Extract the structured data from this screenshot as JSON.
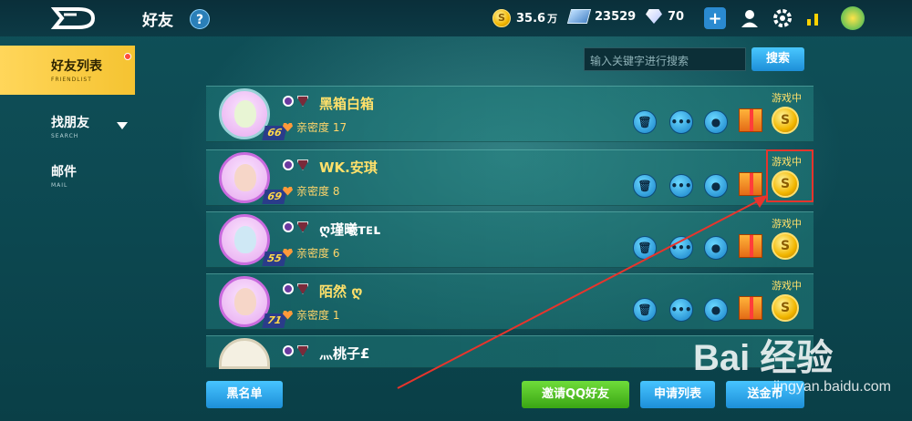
{
  "header": {
    "title": "好友",
    "help": "?",
    "coins": "35.6",
    "coins_unit": "万",
    "tickets": "23529",
    "diamonds": "70"
  },
  "sidebar": {
    "items": [
      {
        "label": "好友列表",
        "sub": "FRIENDLIST"
      },
      {
        "label": "找朋友",
        "sub": "SEARCH"
      },
      {
        "label": "邮件",
        "sub": "MAIL"
      }
    ]
  },
  "search": {
    "placeholder": "输入关键字进行搜索",
    "button": "搜索"
  },
  "friends": [
    {
      "level": "66",
      "name": "黑箱白箱",
      "intimacy": "亲密度 17",
      "status": "游戏中"
    },
    {
      "level": "69",
      "name": "WK.安琪",
      "intimacy": "亲密度 8",
      "status": "游戏中"
    },
    {
      "level": "55",
      "name": "ღ瑾曦ᴛᴇʟ",
      "intimacy": "亲密度 6",
      "status": "游戏中"
    },
    {
      "level": "71",
      "name": "陌然 ღ",
      "intimacy": "亲密度 1",
      "status": "游戏中"
    },
    {
      "level": "",
      "name": "灬桃子£",
      "intimacy": "",
      "status": ""
    }
  ],
  "bottom": {
    "blacklist": "黑名单",
    "invite_qq": "邀请QQ好友",
    "requests": "申请列表",
    "gold_btn": "送金币"
  },
  "watermark": {
    "main": "Bai 经验",
    "sub": "jingyan.baidu.com"
  },
  "colors": {
    "accent_yellow": "#ffd65a",
    "name_yellow": "#ffe06a",
    "button_blue": "#1d8fd8",
    "invite_green": "#43b316",
    "annotation_red": "#e8342c"
  }
}
